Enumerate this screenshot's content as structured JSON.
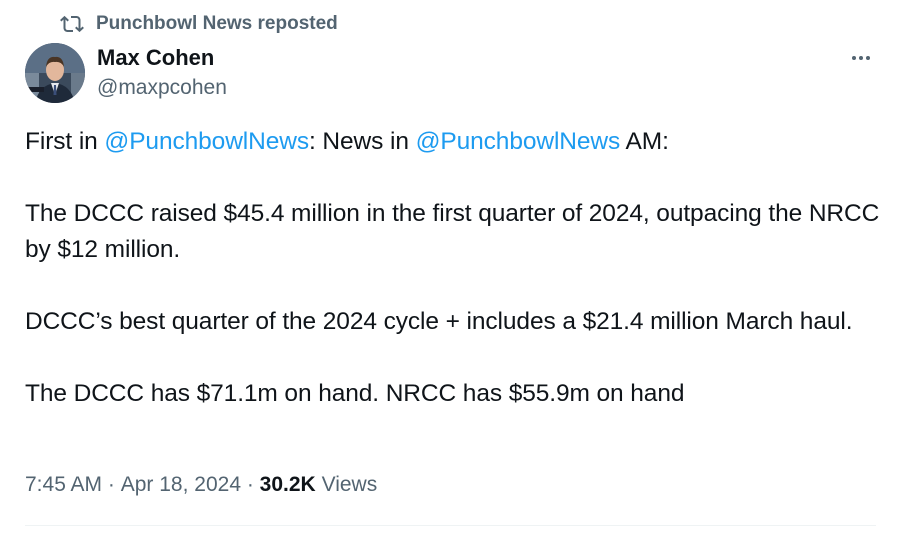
{
  "repost": {
    "label": "Punchbowl News reposted",
    "icon": "repost-icon"
  },
  "author": {
    "name": "Max Cohen",
    "handle": "@maxpcohen"
  },
  "tweet": {
    "line1": {
      "prefix": "First in ",
      "mention1": "@PunchbowlNews",
      "middle": ": News in ",
      "mention2": "@PunchbowlNews",
      "suffix": " AM:"
    },
    "paragraph2": "The DCCC raised $45.4 million in the first quarter of 2024, outpacing the NRCC by $12 million.",
    "paragraph3": "DCCC’s best quarter of the 2024 cycle + includes a $21.4 million March haul.",
    "paragraph4": "The DCCC has $71.1m on hand. NRCC has $55.9m on hand"
  },
  "meta": {
    "time": "7:45 AM",
    "separator": " · ",
    "date": "Apr 18, 2024",
    "views_count": "30.2K",
    "views_label": "Views"
  },
  "colors": {
    "accent": "#1d9bf0",
    "text": "#0f1419",
    "secondary": "#536471"
  }
}
